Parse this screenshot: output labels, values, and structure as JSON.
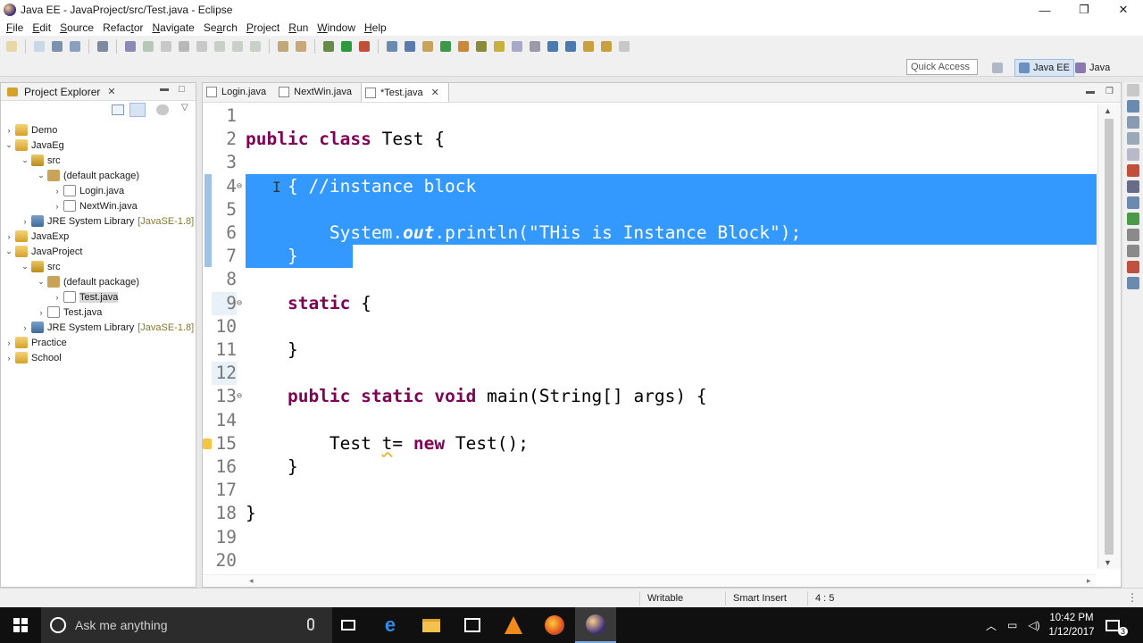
{
  "window": {
    "title": "Java EE - JavaProject/src/Test.java - Eclipse",
    "minimize": "—",
    "restore": "❐",
    "close": "✕"
  },
  "menu": [
    {
      "label": "File",
      "mnemonic": "F",
      "rest": "ile"
    },
    {
      "label": "Edit",
      "mnemonic": "E",
      "rest": "dit"
    },
    {
      "label": "Source",
      "mnemonic": "S",
      "rest": "ource"
    },
    {
      "label": "Refactor",
      "mnemonic": "t",
      "pre": "Refac",
      "rest": "or"
    },
    {
      "label": "Navigate",
      "mnemonic": "N",
      "rest": "avigate"
    },
    {
      "label": "Search",
      "mnemonic": "a",
      "pre": "Se",
      "rest": "rch"
    },
    {
      "label": "Project",
      "mnemonic": "P",
      "rest": "roject"
    },
    {
      "label": "Run",
      "mnemonic": "R",
      "rest": "un"
    },
    {
      "label": "Window",
      "mnemonic": "W",
      "rest": "indow"
    },
    {
      "label": "Help",
      "mnemonic": "H",
      "rest": "elp"
    }
  ],
  "toolbar": {
    "quick_access_placeholder": "Quick Access",
    "perspectives": [
      {
        "label": "Java EE",
        "active": true
      },
      {
        "label": "Java",
        "active": false
      }
    ]
  },
  "explorer": {
    "tab_label": "Project Explorer",
    "close": "✕",
    "tree": [
      {
        "label": "Demo",
        "depth": 0,
        "expanded": false,
        "icon": "project-icon"
      },
      {
        "label": "JavaEg",
        "depth": 0,
        "expanded": true,
        "icon": "project-icon"
      },
      {
        "label": "src",
        "depth": 1,
        "expanded": true,
        "icon": "source-folder-icon"
      },
      {
        "label": "(default package)",
        "depth": 2,
        "expanded": true,
        "icon": "package-icon"
      },
      {
        "label": "Login.java",
        "depth": 3,
        "expanded": false,
        "icon": "java-file-icon"
      },
      {
        "label": "NextWin.java",
        "depth": 3,
        "expanded": false,
        "icon": "java-file-icon"
      },
      {
        "label": "JRE System Library",
        "decor": "[JavaSE-1.8]",
        "depth": 1,
        "expanded": false,
        "icon": "library-icon"
      },
      {
        "label": "JavaExp",
        "depth": 0,
        "expanded": false,
        "icon": "project-icon"
      },
      {
        "label": "JavaProject",
        "depth": 0,
        "expanded": true,
        "icon": "project-icon"
      },
      {
        "label": "src",
        "depth": 1,
        "expanded": true,
        "icon": "source-folder-icon"
      },
      {
        "label": "(default package)",
        "depth": 2,
        "expanded": true,
        "icon": "package-icon"
      },
      {
        "label": "Test.java",
        "depth": 3,
        "expanded": false,
        "icon": "java-file-icon",
        "selected": true
      },
      {
        "label": "Test.java",
        "depth": 2,
        "expanded": false,
        "icon": "java-file-icon"
      },
      {
        "label": "JRE System Library",
        "decor": "[JavaSE-1.8]",
        "depth": 1,
        "expanded": false,
        "icon": "library-icon"
      },
      {
        "label": "Practice",
        "depth": 0,
        "expanded": false,
        "icon": "project-icon"
      },
      {
        "label": "School",
        "depth": 0,
        "expanded": false,
        "icon": "project-icon"
      }
    ]
  },
  "editor": {
    "tabs": [
      {
        "label": "Login.java",
        "active": false
      },
      {
        "label": "NextWin.java",
        "active": false
      },
      {
        "label": "*Test.java",
        "active": true
      }
    ],
    "close": "✕",
    "lines": [
      {
        "n": "1",
        "text": ""
      },
      {
        "n": "2",
        "text": "public class Test {"
      },
      {
        "n": "3",
        "text": ""
      },
      {
        "n": "4",
        "text": "    { //instance block",
        "fold": "⊖"
      },
      {
        "n": "5",
        "text": ""
      },
      {
        "n": "6",
        "text": "        System.out.println(\"THis is Instance Block\");"
      },
      {
        "n": "7",
        "text": "    }"
      },
      {
        "n": "8",
        "text": ""
      },
      {
        "n": "9",
        "text": "    static {",
        "fold": "⊖"
      },
      {
        "n": "10",
        "text": ""
      },
      {
        "n": "11",
        "text": "    }"
      },
      {
        "n": "12",
        "text": ""
      },
      {
        "n": "13",
        "text": "    public static void main(String[] args) {",
        "fold": "⊖"
      },
      {
        "n": "14",
        "text": ""
      },
      {
        "n": "15",
        "text": "        Test t= new Test();"
      },
      {
        "n": "16",
        "text": "    }"
      },
      {
        "n": "17",
        "text": ""
      },
      {
        "n": "18",
        "text": "}"
      },
      {
        "n": "19",
        "text": ""
      },
      {
        "n": "20",
        "text": ""
      }
    ]
  },
  "status": {
    "writable": "Writable",
    "insert_mode": "Smart Insert",
    "position": "4 : 5"
  },
  "taskbar": {
    "search_placeholder": "Ask me anything",
    "time": "10:42 PM",
    "date": "1/12/2017",
    "notifications": "3"
  },
  "colors": {
    "selection": "#3399ff",
    "keyword": "#7f0055",
    "line_number": "#787878"
  }
}
